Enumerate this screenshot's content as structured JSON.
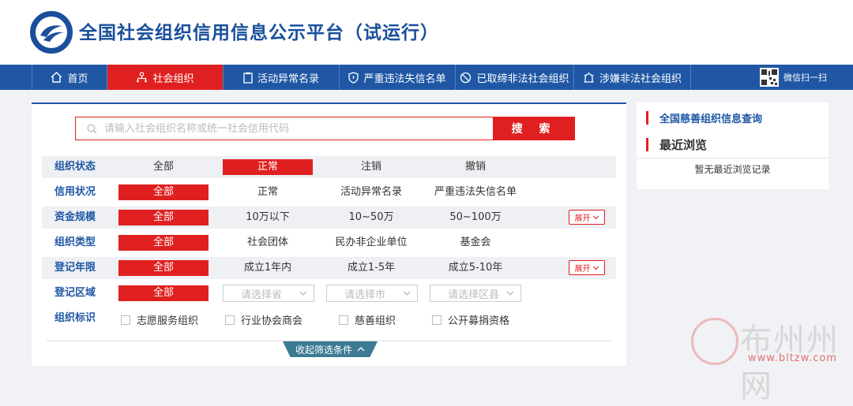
{
  "site": {
    "title": "全国社会组织信用信息公示平台（试运行）"
  },
  "nav": {
    "items": [
      {
        "label": "首页",
        "icon": "home-icon"
      },
      {
        "label": "社会组织",
        "icon": "org-tree-icon",
        "active": true
      },
      {
        "label": "活动异常名录",
        "icon": "clipboard-icon"
      },
      {
        "label": "严重违法失信名单",
        "icon": "shield-icon"
      },
      {
        "label": "已取缔非法社会组织",
        "icon": "ban-icon"
      },
      {
        "label": "涉嫌非法社会组织",
        "icon": "alarm-icon"
      }
    ],
    "wechat_label": "微信扫一扫"
  },
  "search": {
    "placeholder": "请输入社会组织名称或统一社会信用代码",
    "button": "搜 索"
  },
  "filters": {
    "status": {
      "label": "组织状态",
      "options": [
        "全部",
        "正常",
        "注销",
        "撤销"
      ],
      "selected": "正常"
    },
    "credit": {
      "label": "信用状况",
      "options": [
        "全部",
        "正常",
        "活动异常名录",
        "严重违法失信名单"
      ],
      "selected": "全部"
    },
    "capital": {
      "label": "资金规模",
      "options": [
        "全部",
        "10万以下",
        "10~50万",
        "50~100万"
      ],
      "selected": "全部",
      "expand": "展开"
    },
    "type": {
      "label": "组织类型",
      "options": [
        "全部",
        "社会团体",
        "民办非企业单位",
        "基金会"
      ],
      "selected": "全部"
    },
    "age": {
      "label": "登记年限",
      "options": [
        "全部",
        "成立1年内",
        "成立1-5年",
        "成立5-10年"
      ],
      "selected": "全部",
      "expand": "展开"
    },
    "region": {
      "label": "登记区域",
      "all": "全部",
      "province": "请选择省",
      "city": "请选择市",
      "county": "请选择区县"
    },
    "tags": {
      "label": "组织标识",
      "options": [
        "志愿服务组织",
        "行业协会商会",
        "慈善组织",
        "公开募捐资格"
      ]
    }
  },
  "collapse_label": "收起筛选条件",
  "sidebar": {
    "link": "全国慈善组织信息查询",
    "recent_title": "最近浏览",
    "recent_empty": "暂无最近浏览记录"
  },
  "watermark": {
    "text": "布州州网",
    "url": "www.bltzw.com"
  },
  "colors": {
    "primary": "#1f57a4",
    "accent": "#e02020"
  }
}
